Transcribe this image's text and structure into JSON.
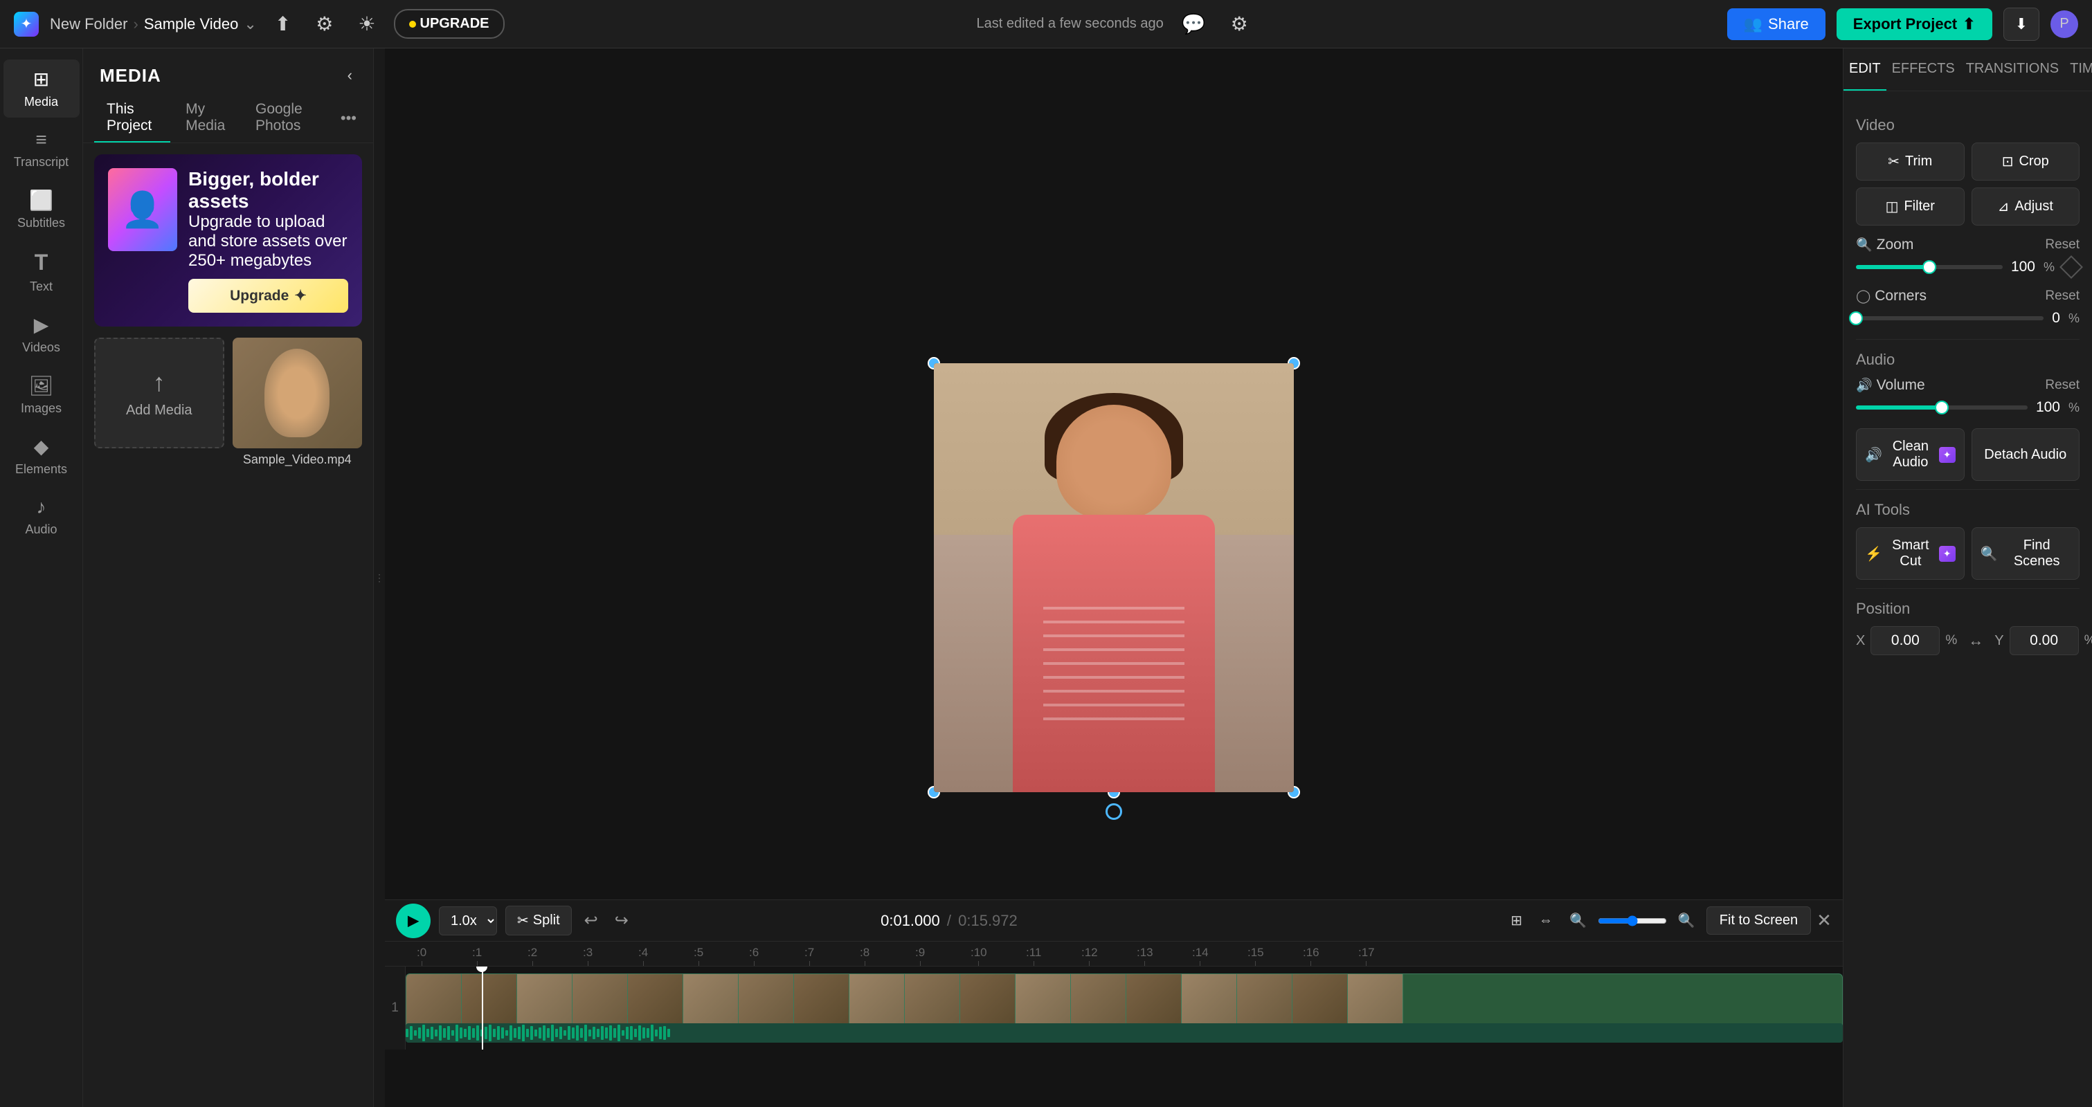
{
  "app": {
    "logo_text": "✦",
    "breadcrumb_folder": "New Folder",
    "breadcrumb_sep": "›",
    "breadcrumb_project": "Sample Video",
    "dropdown_icon": "⌄",
    "last_edited": "Last edited a few seconds ago",
    "upgrade_label": "UPGRADE",
    "upgrade_dot": "✦",
    "share_label": "Share",
    "export_label": "Export Project",
    "export_icon": "⬆",
    "download_icon": "⬇",
    "user_icon": "P"
  },
  "left_sidebar": {
    "items": [
      {
        "id": "media",
        "icon": "⊞",
        "label": "Media",
        "active": true
      },
      {
        "id": "transcript",
        "icon": "≡",
        "label": "Transcript"
      },
      {
        "id": "subtitles",
        "icon": "⬜",
        "label": "Subtitles"
      },
      {
        "id": "text",
        "icon": "T",
        "label": "Text"
      },
      {
        "id": "videos",
        "icon": "▶",
        "label": "Videos"
      },
      {
        "id": "images",
        "icon": "🖼",
        "label": "Images"
      },
      {
        "id": "elements",
        "icon": "◆",
        "label": "Elements"
      },
      {
        "id": "audio",
        "icon": "♪",
        "label": "Audio"
      }
    ]
  },
  "media_panel": {
    "title": "MEDIA",
    "tabs": [
      {
        "id": "this-project",
        "label": "This Project",
        "active": true
      },
      {
        "id": "my-media",
        "label": "My Media"
      },
      {
        "id": "google-photos",
        "label": "Google Photos"
      }
    ],
    "more_icon": "•••",
    "upgrade_banner": {
      "title": "Bigger, bolder assets",
      "description": "Upgrade to upload and store assets over 250+ megabytes",
      "btn_label": "Upgrade",
      "btn_icon": "✦"
    },
    "add_media_label": "Add Media",
    "add_media_icon": "↑",
    "video_filename": "Sample_Video.mp4"
  },
  "right_panel": {
    "tabs": [
      {
        "id": "edit",
        "label": "EDIT",
        "active": true
      },
      {
        "id": "effects",
        "label": "EFFECTS"
      },
      {
        "id": "transitions",
        "label": "TRANSITIONS"
      },
      {
        "id": "timing",
        "label": "TIMING"
      }
    ],
    "video_section": {
      "title": "Video",
      "trim_label": "Trim",
      "trim_icon": "✂",
      "crop_label": "Crop",
      "crop_icon": "⊡",
      "filter_label": "Filter",
      "filter_icon": "◫",
      "adjust_label": "Adjust",
      "adjust_icon": "⊿"
    },
    "zoom": {
      "label": "Zoom",
      "reset_label": "Reset",
      "value": "100",
      "unit": "%",
      "fill_pct": 50
    },
    "corners": {
      "label": "Corners",
      "reset_label": "Reset",
      "value": "0",
      "unit": "%",
      "fill_pct": 0
    },
    "audio_section": {
      "title": "Audio",
      "volume_label": "Volume",
      "volume_reset": "Reset",
      "volume_value": "100",
      "volume_unit": "%",
      "volume_fill_pct": 50,
      "clean_audio_label": "Clean Audio",
      "clean_audio_icon": "🔊",
      "clean_audio_badge": "✦",
      "detach_audio_label": "Detach Audio"
    },
    "ai_tools": {
      "title": "AI Tools",
      "smart_cut_label": "Smart Cut",
      "smart_cut_icon": "⚡",
      "smart_cut_badge": "✦",
      "find_scenes_label": "Find Scenes",
      "find_scenes_icon": "🔍"
    },
    "position": {
      "title": "Position",
      "x_label": "X",
      "x_value": "0.00",
      "y_label": "Y",
      "y_value": "0.00",
      "unit": "%",
      "link_icon": "↔"
    }
  },
  "timeline": {
    "play_icon": "▶",
    "speed": "1.0x",
    "split_label": "Split",
    "split_icon": "✂",
    "undo_icon": "↩",
    "redo_icon": "↪",
    "time_current": "0:01.000",
    "time_separator": "/",
    "time_total": "0:15.972",
    "zoom_in_icon": "🔍",
    "zoom_out_icon": "🔍",
    "fit_screen_label": "Fit to Screen",
    "close_icon": "✕",
    "ruler_marks": [
      "0",
      ":1",
      ":2",
      ":3",
      ":4",
      ":5",
      ":6",
      ":7",
      ":8",
      ":9",
      ":10",
      ":11",
      ":12",
      ":13",
      ":14",
      ":15",
      ":16",
      ":17"
    ],
    "track_number": "1"
  }
}
